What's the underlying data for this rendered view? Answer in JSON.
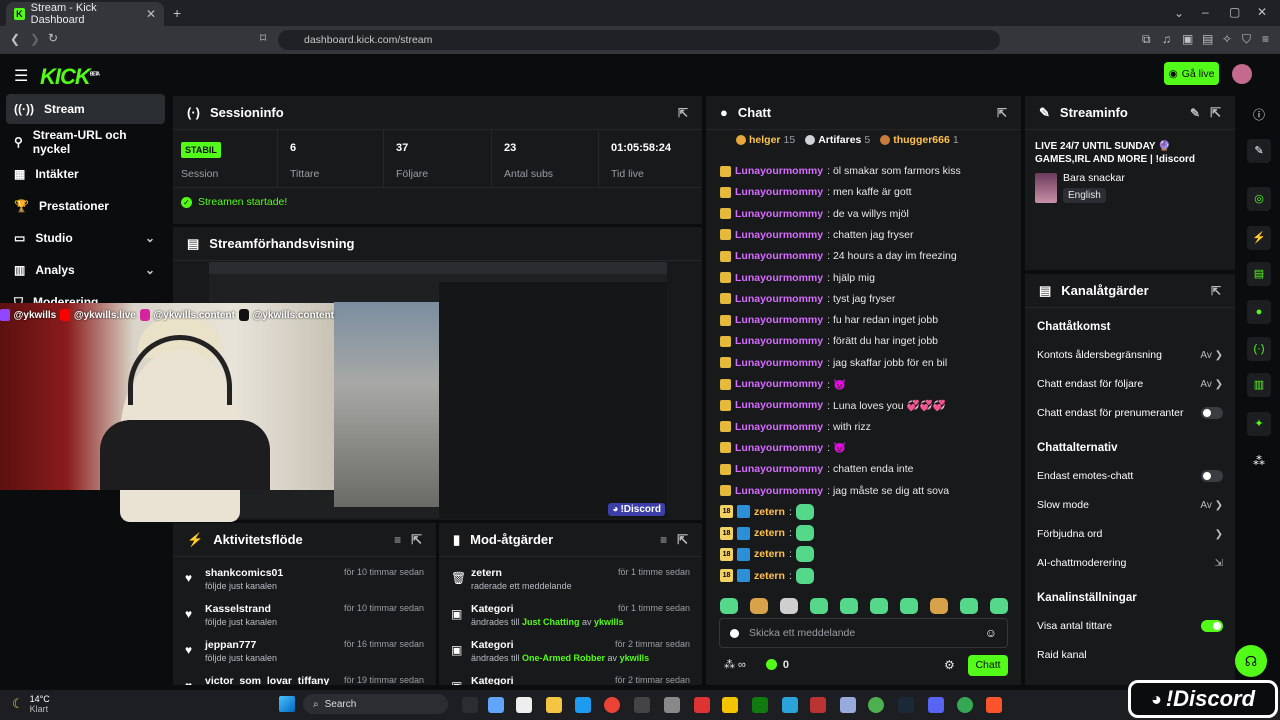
{
  "browser": {
    "tab_title": "Stream - Kick Dashboard",
    "tab_close": "✕",
    "new_tab": "+",
    "url": "dashboard.kick.com/stream"
  },
  "app": {
    "logo": "KICK",
    "logo_sup": "BETA",
    "go_live_label": "Gå live",
    "accent": "#53fc18"
  },
  "sidebar": {
    "items": [
      {
        "label": "Stream",
        "icon": "broadcast-icon"
      },
      {
        "label": "Stream-URL och nyckel",
        "icon": "key-icon"
      },
      {
        "label": "Intäkter",
        "icon": "chart-icon"
      },
      {
        "label": "Prestationer",
        "icon": "trophy-icon"
      },
      {
        "label": "Studio",
        "icon": "studio-icon"
      },
      {
        "label": "Analys",
        "icon": "analytics-icon"
      },
      {
        "label": "Moderering",
        "icon": "shield-icon"
      }
    ]
  },
  "session": {
    "title": "Sessioninfo",
    "status_badge": "STABIL",
    "status_label": "Session",
    "stats": [
      {
        "value": "6",
        "label": "Tittare"
      },
      {
        "value": "37",
        "label": "Följare"
      },
      {
        "value": "23",
        "label": "Antal subs"
      },
      {
        "value": "01:05:58:24",
        "label": "Tid live"
      }
    ],
    "started_msg": "Streamen startade!"
  },
  "preview": {
    "title": "Streamförhandsvisning",
    "overlay_handles": [
      "@ykwills",
      "@ykwills.live",
      "@ykwills.content",
      "@ykwills.content"
    ],
    "discord_tag": "!Discord"
  },
  "activity": {
    "title": "Aktivitetsflöde",
    "items": [
      {
        "name": "shankcomics01",
        "sub": "följde just kanalen",
        "time": "för 10 timmar sedan"
      },
      {
        "name": "Kasselstrand",
        "sub": "följde just kanalen",
        "time": "för 10 timmar sedan"
      },
      {
        "name": "jeppan777",
        "sub": "följde just kanalen",
        "time": "för 16 timmar sedan"
      },
      {
        "name": "victor_som_lovar_tiffany",
        "sub": "",
        "time": "för 19 timmar sedan"
      }
    ]
  },
  "mod": {
    "title": "Mod-åtgärder",
    "items": [
      {
        "name": "zetern",
        "sub": "raderade ett meddelande",
        "time": "för 1 timme sedan"
      },
      {
        "name": "Kategori",
        "sub_pre": "ändrades till ",
        "sub_hl": "Just Chatting",
        "sub_mid": " av ",
        "sub_user": "ykwills",
        "time": "för 1 timme sedan"
      },
      {
        "name": "Kategori",
        "sub_pre": "ändrades till ",
        "sub_hl": "One-Armed Robber",
        "sub_mid": " av ",
        "sub_user": "ykwills",
        "time": "för 2 timmar sedan"
      },
      {
        "name": "Kategori",
        "sub_pre": "",
        "sub_hl": "",
        "sub_mid": "",
        "sub_user": "",
        "time": "för 2 timmar sedan"
      }
    ]
  },
  "chat": {
    "title": "Chatt",
    "top_users": [
      {
        "name": "helger",
        "count": "15"
      },
      {
        "name": "Artifares",
        "count": "5"
      },
      {
        "name": "thugger666",
        "count": "1"
      }
    ],
    "messages": [
      {
        "user": "Lunayourmommy",
        "text": "öl smakar som farmors kiss"
      },
      {
        "user": "Lunayourmommy",
        "text": "men kaffe är gott"
      },
      {
        "user": "Lunayourmommy",
        "text": "de va willys mjöl"
      },
      {
        "user": "Lunayourmommy",
        "text": "chatten jag fryser"
      },
      {
        "user": "Lunayourmommy",
        "text": "24 hours a day im freezing"
      },
      {
        "user": "Lunayourmommy",
        "text": "hjälp mig"
      },
      {
        "user": "Lunayourmommy",
        "text": "tyst jag fryser"
      },
      {
        "user": "Lunayourmommy",
        "text": "fu har redan inget jobb"
      },
      {
        "user": "Lunayourmommy",
        "text": "förätt du har inget jobb"
      },
      {
        "user": "Lunayourmommy",
        "text": "jag skaffar jobb för en bil"
      },
      {
        "user": "Lunayourmommy",
        "text": "😈"
      },
      {
        "user": "Lunayourmommy",
        "text": "Luna loves you 💞💞💞"
      },
      {
        "user": "Lunayourmommy",
        "text": "with rizz"
      },
      {
        "user": "Lunayourmommy",
        "text": "😈"
      },
      {
        "user": "Lunayourmommy",
        "text": "chatten enda inte"
      },
      {
        "user": "Lunayourmommy",
        "text": "jag måste se dig att sova"
      }
    ],
    "zetern_lines": [
      {
        "badge": "18",
        "user": "zetern"
      },
      {
        "badge": "18",
        "user": "zetern"
      },
      {
        "badge": "18",
        "user": "zetern"
      },
      {
        "badge": "18",
        "user": "zetern"
      }
    ],
    "input_placeholder": "Skicka ett meddelande",
    "points": "0",
    "send_label": "Chatt"
  },
  "streaminfo": {
    "title": "Streaminfo",
    "stream_title": "LIVE 24/7 UNTIL SUNDAY 🔮 GAMES,IRL AND MORE | !discord",
    "category": "Bara snackar",
    "language": "English"
  },
  "channel": {
    "title": "Kanalåtgärder",
    "section_access": "Chattåtkomst",
    "age_restriction": "Kontots åldersbegränsning",
    "age_value": "Av",
    "followers_only": "Chatt endast för följare",
    "followers_value": "Av",
    "subs_only": "Chatt endast för prenumeranter",
    "section_options": "Chattalternativ",
    "emotes_only": "Endast emotes-chatt",
    "slow_mode": "Slow mode",
    "slow_value": "Av",
    "banned_words": "Förbjudna ord",
    "ai_mod": "AI-chattmoderering",
    "section_settings": "Kanalinställningar",
    "show_viewers": "Visa antal tittare",
    "raid": "Raid kanal"
  },
  "taskbar": {
    "weather_temp": "14°C",
    "weather_desc": "Klart",
    "search_label": "Search"
  },
  "discord_badge": "!Discord"
}
